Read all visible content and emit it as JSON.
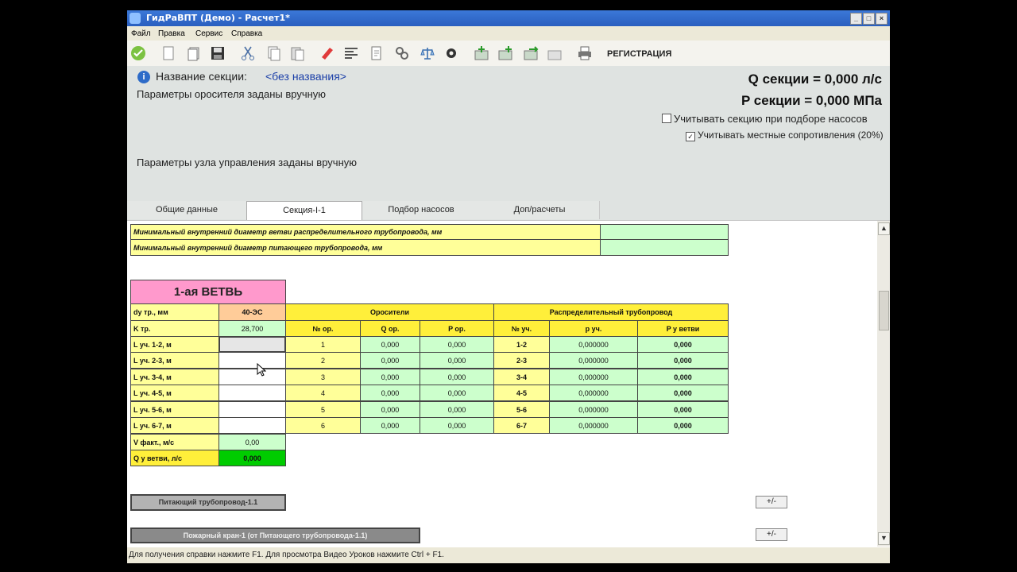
{
  "window": {
    "title": "ГидРаВПТ (Демо) - Расчет1*"
  },
  "menu": [
    "Файл",
    "Правка",
    "Сервис",
    "Справка"
  ],
  "toolbar": {
    "registration_label": "РЕГИСТРАЦИЯ"
  },
  "section": {
    "name_label": "Название секции:",
    "name_value": "<без названия>",
    "sprinkler_params": "Параметры оросителя заданы вручную",
    "control_node_params": "Параметры узла управления заданы вручную",
    "q_section": "Q секции = 0,000 л/с",
    "p_section": "P секции = 0,000 МПа",
    "check_pump": "Учитывать секцию при подборе насосов",
    "check_local": "Учитывать местные сопротивления (20%)"
  },
  "tabs": [
    "Общие данные",
    "Секция-I-1",
    "Подбор насосов",
    "Доп/расчеты"
  ],
  "params": [
    "Минимальный внутренний диаметр ветви распределительного трубопровода, мм",
    "Минимальный внутренний диаметр питающего трубопровода, мм"
  ],
  "branch": {
    "title": "1-ая ВЕТВЬ",
    "dy_label": "dy тр., мм",
    "dy_value": "40-ЭС",
    "k_label": "K тр.",
    "k_value": "28,700",
    "segments": [
      "L уч. 1-2, м",
      "L уч. 2-3, м",
      "L уч. 3-4, м",
      "L уч. 4-5, м",
      "L уч. 5-6, м",
      "L уч. 6-7, м"
    ],
    "v_label": "V факт., м/с",
    "v_value": "0,00",
    "q_label": "Q у ветви, л/с",
    "q_value": "0,000"
  },
  "sprinklers": {
    "header": "Оросители",
    "cols": [
      "№ ор.",
      "Q ор.",
      "P ор."
    ],
    "rows": [
      [
        "1",
        "0,000",
        "0,000"
      ],
      [
        "2",
        "0,000",
        "0,000"
      ],
      [
        "3",
        "0,000",
        "0,000"
      ],
      [
        "4",
        "0,000",
        "0,000"
      ],
      [
        "5",
        "0,000",
        "0,000"
      ],
      [
        "6",
        "0,000",
        "0,000"
      ]
    ]
  },
  "distribution": {
    "header": "Распределительный трубопровод",
    "cols": [
      "№ уч.",
      "р уч.",
      "P у ветви"
    ],
    "rows": [
      [
        "1-2",
        "0,000000",
        "0,000"
      ],
      [
        "2-3",
        "0,000000",
        "0,000"
      ],
      [
        "3-4",
        "0,000000",
        "0,000"
      ],
      [
        "4-5",
        "0,000000",
        "0,000"
      ],
      [
        "5-6",
        "0,000000",
        "0,000"
      ],
      [
        "6-7",
        "0,000000",
        "0,000"
      ]
    ]
  },
  "buttons": {
    "supply": "Питающий трубопровод-1.1",
    "hydrant": "Пожарный кран-1 (от Питающего трубопровода-1.1)",
    "pm": "+/-"
  },
  "status": "Для получения справки нажмите F1. Для просмотра Видео Уроков нажмите Ctrl + F1."
}
